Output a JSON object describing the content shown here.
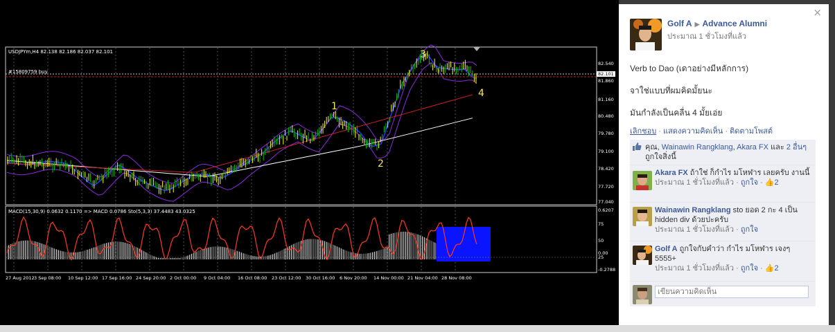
{
  "chart": {
    "symbol_header": "USDJPYm,H4  82.138 82.186 82.037 82.101",
    "order_label": "#15809759 buy",
    "macd_header": "MACD(15,30,9) 0.0632 0.1170  => MACD 0.0786  Sto(5,3,3) 37.4483 43.0325",
    "price_ticks": [
      "82.540",
      "82.101",
      "81.860",
      "81.160",
      "80.480",
      "79.780",
      "79.100",
      "78.420",
      "77.720",
      "77.040"
    ],
    "macd_ticks": [
      "0.6207",
      "75",
      "50",
      "0.00",
      "25",
      "-0.2788"
    ],
    "time_ticks": [
      "27 Aug 2012",
      "3 Sep 08:00",
      "10 Sep 12:00",
      "17 Sep 16:00",
      "24 Sep 20:00",
      "2 Oct 00:00",
      "9 Oct 04:00",
      "16 Oct 08:00",
      "23 Oct 12:00",
      "30 Oct 16:00",
      "6 Nov 20:00",
      "14 Nov 00:00",
      "21 Nov 04:00",
      "28 Nov 08:00"
    ],
    "wave_labels": [
      "1",
      "2",
      "3",
      "4"
    ],
    "colors": {
      "background": "#000000",
      "bull": "#00c000",
      "bear": "#ffff00",
      "ma_white": "#ffffff",
      "ma_red": "#d02020",
      "band_purple": "#8a2be2",
      "band_blue": "#2040ff",
      "macd_red": "#ff3b1f",
      "highlight": "#0000ff",
      "wave_label": "#f5e65a"
    }
  },
  "post": {
    "author": "Golf A",
    "group": "Advance Alumni",
    "time": "ประมาณ 1 ชั่วโมงที่แล้ว",
    "lines": [
      "Verb to Dao (เดาอย่างมีหลักการ)",
      "จาใช่แบบที่ผมคิดมั้ยนะ",
      "มันกำลังเป็นคลื่น 4 มั้ยเอ่ย"
    ],
    "actions": {
      "unlike": "เลิกชอบ",
      "comment": "แสดงความคิดเห็น",
      "follow": "ติดตามโพสต์"
    },
    "likes": {
      "you": "คุณ,",
      "name1": "Wainawin Rangklang",
      "sep": ",",
      "name2": "Akara FX",
      "and": "และ",
      "others": "2 อื่นๆ",
      "suffix": "ถูกใจสิ่งนี้"
    }
  },
  "comments": [
    {
      "name": "Akara FX",
      "text": "ถ้าใช่ ก็กำไร มโหฬาร เลยครับ งานนี้",
      "time": "ประมาณ 1 ชั่วโมงที่แล้ว",
      "like": "ถูกใจ",
      "likes": "2"
    },
    {
      "name": "Wainawin Rangklang",
      "text": "sto ยอด 2 กะ 4 เป็น hidden div ด้วยปะครับ",
      "time": "ประมาณ 1 ชั่วโมงที่แล้ว",
      "like": "ถูกใจ",
      "likes": ""
    },
    {
      "name": "Golf A",
      "text": "ถูกใจกับคำว่า กำไร มโหฬาร เจงๆ 5555+",
      "time": "ประมาณ 1 ชั่วโมงที่แล้ว",
      "like": "ถูกใจ",
      "likes": "2"
    }
  ],
  "comment_box": {
    "placeholder": "เขียนความคิดเห็น"
  },
  "close_label": "×"
}
